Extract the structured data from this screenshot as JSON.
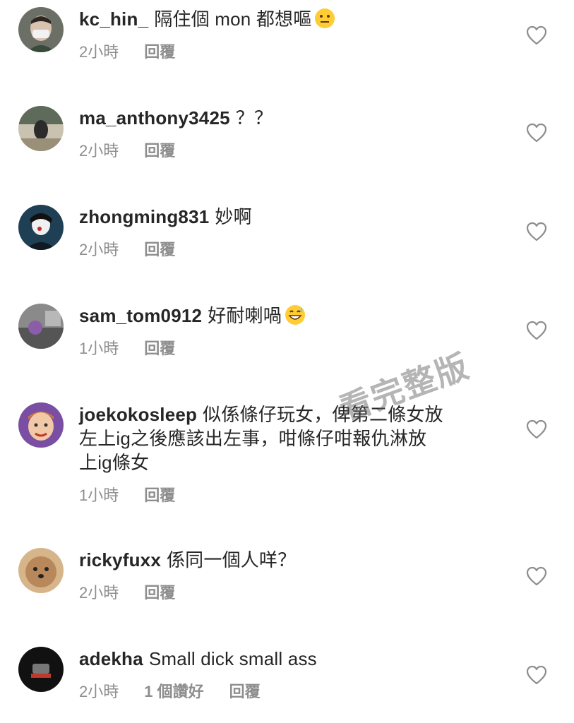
{
  "comments": [
    {
      "username": "kc_hin_",
      "text": "隔住個 mon 都想嘔",
      "emoji": "neutral-face-emoji",
      "time": "2小時",
      "likes": "",
      "reply": "回覆"
    },
    {
      "username": "ma_anthony3425",
      "text": "？？",
      "emoji": "",
      "time": "2小時",
      "likes": "",
      "reply": "回覆"
    },
    {
      "username": "zhongming831",
      "text": "妙啊",
      "emoji": "",
      "time": "2小時",
      "likes": "",
      "reply": "回覆"
    },
    {
      "username": "sam_tom0912",
      "text": "好耐喇喎",
      "emoji": "grinning-sweat-emoji",
      "time": "1小時",
      "likes": "",
      "reply": "回覆"
    },
    {
      "username": "joekokosleep",
      "text_lines": [
        "似係條仔玩女，俾第二條女放",
        "左上ig之後應該出左事，咁條仔咁報仇淋放",
        "上ig條女"
      ],
      "time": "1小時",
      "likes": "",
      "reply": "回覆"
    },
    {
      "username": "rickyfuxx",
      "text": "係同一個人咩？",
      "emoji": "",
      "time": "2小時",
      "likes": "",
      "reply": "回覆"
    },
    {
      "username": "adekha",
      "text": "Small dick small ass",
      "emoji": "",
      "time": "2小時",
      "likes": "1 個讚好",
      "reply": "回覆"
    }
  ],
  "watermark": "看完整版",
  "colors": {
    "text": "#262626",
    "meta": "#8e8e8e",
    "background": "#ffffff"
  }
}
